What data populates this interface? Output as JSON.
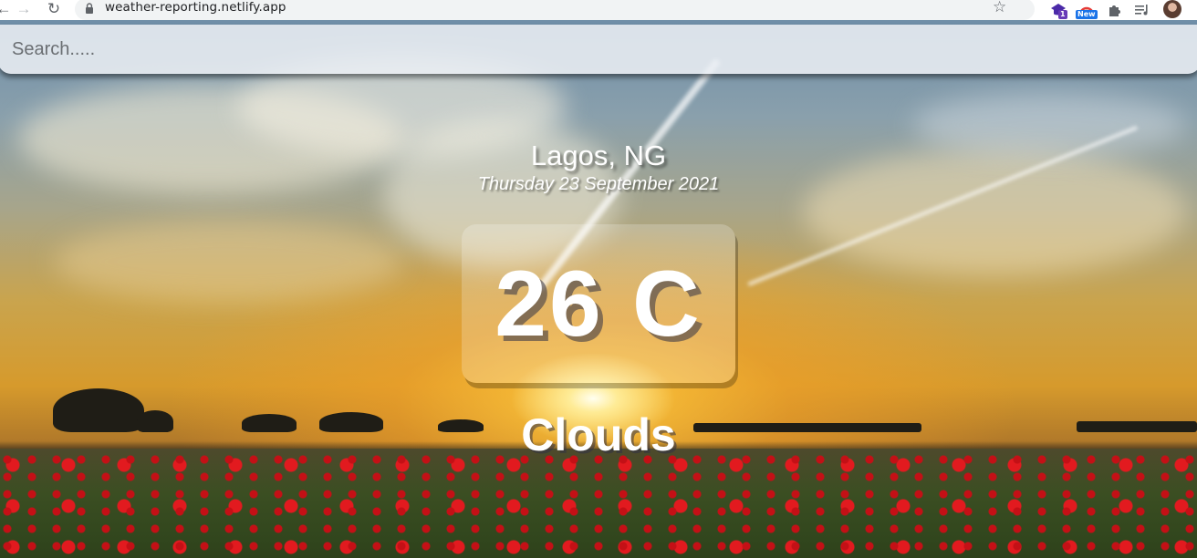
{
  "browser": {
    "url": "weather-reporting.netlify.app",
    "extension_badge_count": "1",
    "extension_new_label": "New"
  },
  "search": {
    "placeholder": "Search.....",
    "value": ""
  },
  "weather": {
    "location": "Lagos, NG",
    "date": "Thursday 23 September 2021",
    "temperature": "26 C",
    "condition": "Clouds"
  },
  "icons": {
    "back": "back-arrow-icon",
    "forward": "forward-arrow-icon",
    "reload": "reload-icon",
    "lock": "lock-icon",
    "bookmark": "star-icon",
    "extensions": "puzzle-icon",
    "reading_list": "reading-list-icon"
  },
  "colors": {
    "text": "#ffffff",
    "search_bar": "#ecf0f5",
    "omnibox": "#f1f3f4"
  }
}
